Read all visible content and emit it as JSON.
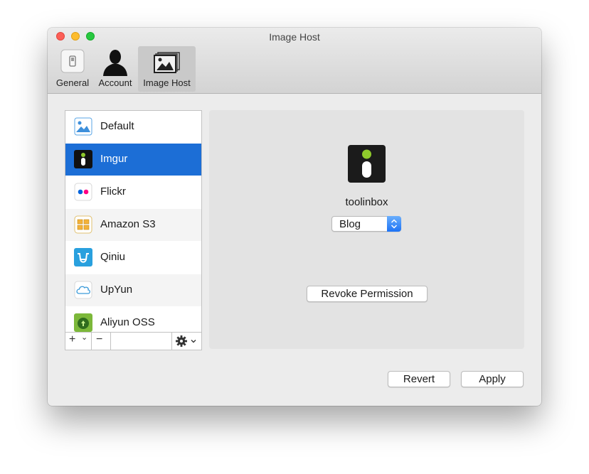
{
  "window": {
    "title": "Image Host"
  },
  "tabs": [
    {
      "label": "General"
    },
    {
      "label": "Account"
    },
    {
      "label": "Image Host"
    }
  ],
  "hosts": [
    {
      "label": "Default",
      "icon": "image-icon"
    },
    {
      "label": "Imgur",
      "icon": "imgur-icon"
    },
    {
      "label": "Flickr",
      "icon": "flickr-icon"
    },
    {
      "label": "Amazon S3",
      "icon": "amazon-s3-icon"
    },
    {
      "label": "Qiniu",
      "icon": "qiniu-icon"
    },
    {
      "label": "UpYun",
      "icon": "cloud-icon"
    },
    {
      "label": "Aliyun OSS",
      "icon": "aliyun-icon"
    }
  ],
  "list_bar": {
    "add": "+",
    "add_caret": "⌄",
    "remove": "−"
  },
  "detail": {
    "account_name": "toolinbox",
    "album_selected": "Blog",
    "revoke_label": "Revoke Permission"
  },
  "footer": {
    "revert_label": "Revert",
    "apply_label": "Apply"
  },
  "colors": {
    "selection": "#1c6ed6",
    "imgur_green": "#8fca2c",
    "flickr_pink": "#ff0084",
    "flickr_blue": "#0063dc"
  }
}
